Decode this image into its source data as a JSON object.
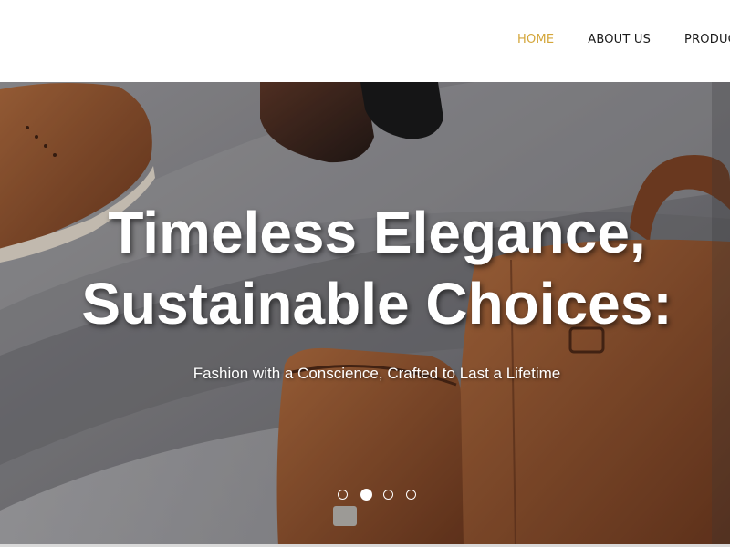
{
  "nav": {
    "items": [
      {
        "label": "HOME",
        "active": true
      },
      {
        "label": "ABOUT US",
        "active": false
      },
      {
        "label": "PRODUCTS",
        "active": false
      }
    ]
  },
  "hero": {
    "title_line1": "Timeless Elegance,",
    "title_line2": "Sustainable Choices:",
    "subtitle": "Fashion with a Conscience, Crafted to Last a Lifetime",
    "slides": {
      "count": 4,
      "active_index": 1
    }
  },
  "colors": {
    "accent": "#d4a63a",
    "nav_text": "#1a1a1a",
    "leather": "#8a4a28"
  }
}
